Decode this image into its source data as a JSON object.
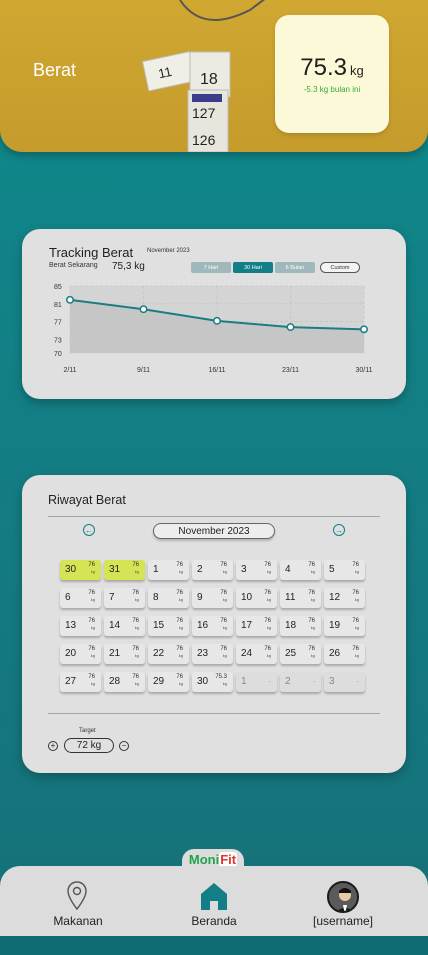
{
  "header": {
    "title": "Berat",
    "tape_numbers": [
      "11",
      "18",
      "127",
      "126"
    ],
    "weight_value": "75.3",
    "weight_unit": "kg",
    "weight_change": "-5.3 kg bulan ini"
  },
  "tracking": {
    "title": "Tracking Berat",
    "month": "November 2023",
    "current_label": "Berat Sekarang",
    "current_value": "75,3 kg",
    "ranges": [
      "7 Hari",
      "30 Hari",
      "6 Bulan"
    ],
    "active_range": "30 Hari",
    "custom_label": "Custom"
  },
  "chart_data": {
    "type": "line",
    "x": [
      "2/11",
      "9/11",
      "16/11",
      "23/11",
      "30/11"
    ],
    "series": [
      {
        "values": [
          81.9,
          79.8,
          77.2,
          75.8,
          75.3
        ]
      }
    ],
    "yticks": [
      85,
      81,
      77,
      73,
      70
    ],
    "ylim": [
      70,
      85
    ],
    "line_color": "#1a7d83",
    "grid": true
  },
  "riwayat": {
    "title": "Riwayat Berat",
    "month": "November 2023",
    "prev_icon": "arrow-left-circle-icon",
    "next_icon": "arrow-right-circle-icon",
    "unit": "kg",
    "days": [
      {
        "num": "30",
        "w": "76",
        "hl": true
      },
      {
        "num": "31",
        "w": "76",
        "hl": true
      },
      {
        "num": "1",
        "w": "76"
      },
      {
        "num": "2",
        "w": "76"
      },
      {
        "num": "3",
        "w": "76"
      },
      {
        "num": "4",
        "w": "76"
      },
      {
        "num": "5",
        "w": "76"
      },
      {
        "num": "6",
        "w": "76"
      },
      {
        "num": "7",
        "w": "76"
      },
      {
        "num": "8",
        "w": "76"
      },
      {
        "num": "9",
        "w": "76"
      },
      {
        "num": "10",
        "w": "76"
      },
      {
        "num": "11",
        "w": "76"
      },
      {
        "num": "12",
        "w": "76"
      },
      {
        "num": "13",
        "w": "76"
      },
      {
        "num": "14",
        "w": "76"
      },
      {
        "num": "15",
        "w": "76"
      },
      {
        "num": "16",
        "w": "76"
      },
      {
        "num": "17",
        "w": "76"
      },
      {
        "num": "18",
        "w": "76"
      },
      {
        "num": "19",
        "w": "76"
      },
      {
        "num": "20",
        "w": "76"
      },
      {
        "num": "21",
        "w": "76"
      },
      {
        "num": "22",
        "w": "76"
      },
      {
        "num": "23",
        "w": "76"
      },
      {
        "num": "24",
        "w": "76"
      },
      {
        "num": "25",
        "w": "76"
      },
      {
        "num": "26",
        "w": "76"
      },
      {
        "num": "27",
        "w": "76"
      },
      {
        "num": "28",
        "w": "76"
      },
      {
        "num": "29",
        "w": "76"
      },
      {
        "num": "30",
        "w": "75.3"
      },
      {
        "num": "1",
        "w": "-",
        "future": true
      },
      {
        "num": "2",
        "w": "-",
        "future": true
      },
      {
        "num": "3",
        "w": "-",
        "future": true
      }
    ],
    "target_label": "Target",
    "target_value": "72 kg",
    "plus_symbol": "+",
    "minus_symbol": "−"
  },
  "nav": {
    "logo_moni": "Moni",
    "logo_fit": "Fit",
    "items": [
      {
        "label": "Makanan",
        "icon": "location-pin-icon"
      },
      {
        "label": "Beranda",
        "icon": "home-icon"
      },
      {
        "label": "[username]",
        "icon": "avatar"
      }
    ]
  },
  "colors": {
    "accent": "#127f86",
    "header": "#c9a02e",
    "highlight": "#d5e454"
  }
}
